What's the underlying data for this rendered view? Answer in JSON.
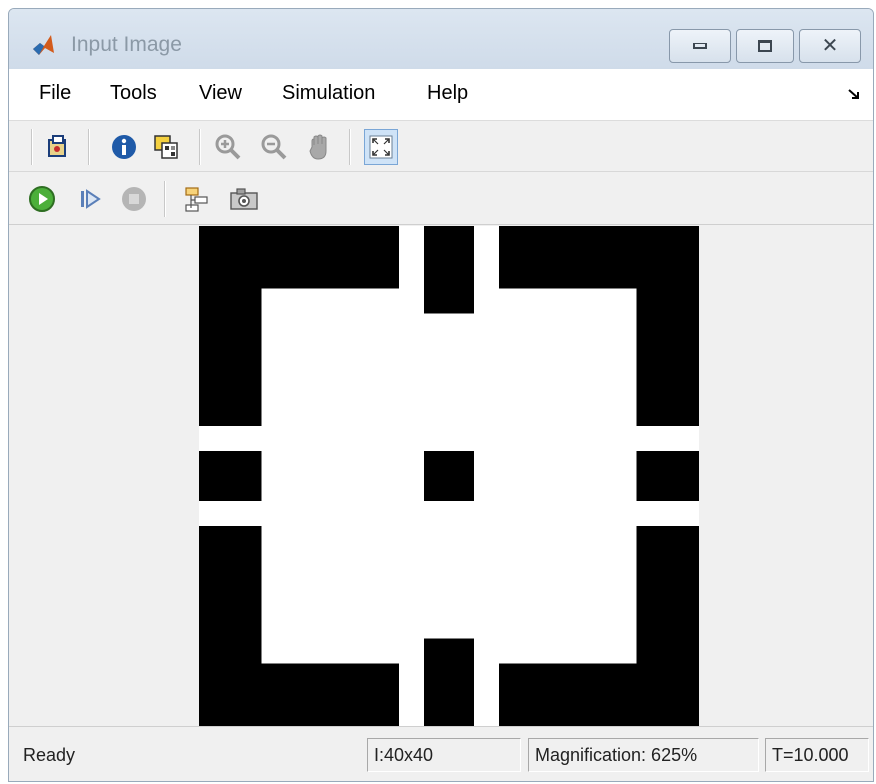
{
  "window": {
    "title": "Input Image"
  },
  "menu": {
    "items": [
      "File",
      "Tools",
      "View",
      "Simulation",
      "Help"
    ]
  },
  "toolbar": {
    "row1_icons": [
      "print-properties-icon",
      "info-icon",
      "image-overlay-icon",
      "zoom-in-icon",
      "zoom-out-icon",
      "pan-hand-icon",
      "fit-to-view-icon"
    ],
    "row2_icons": [
      "run-icon",
      "step-forward-icon",
      "stop-icon",
      "hierarchy-icon",
      "snapshot-camera-icon"
    ],
    "active_tool": "fit-to-view-icon"
  },
  "status": {
    "state": "Ready",
    "image_size": "I:40x40",
    "magnification": "Magnification: 625%",
    "time": "T=10.000"
  },
  "colors": {
    "foreground": "#000000",
    "background": "#ffffff"
  }
}
